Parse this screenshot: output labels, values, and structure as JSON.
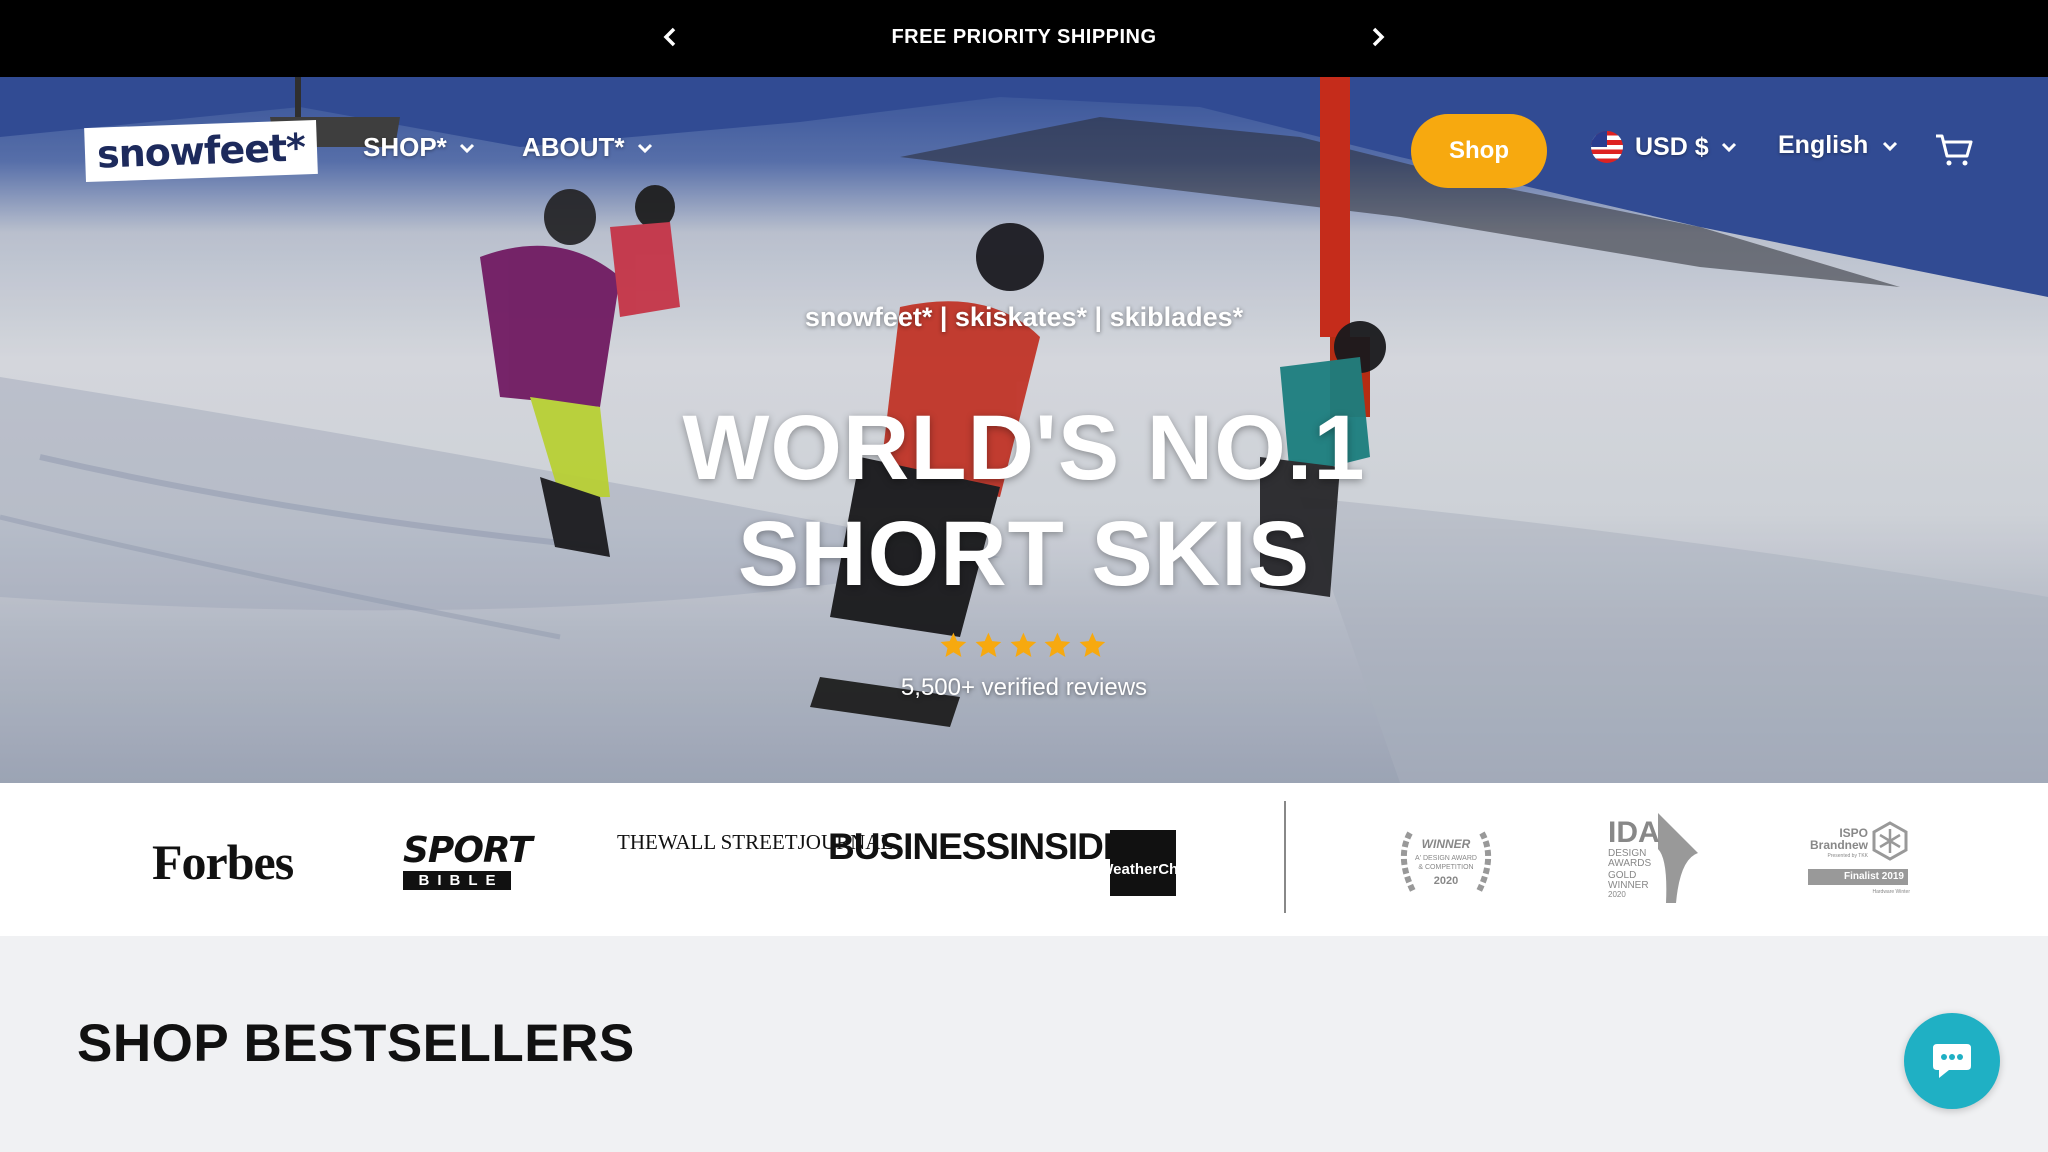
{
  "announcement": {
    "message": "FREE PRIORITY SHIPPING",
    "prev_icon": "chevron-left-icon",
    "next_icon": "chevron-right-icon"
  },
  "header": {
    "logo_text": "snowfeet*",
    "nav": [
      {
        "label": "SHOP*",
        "icon": "chevron-down-icon"
      },
      {
        "label": "ABOUT*",
        "icon": "chevron-down-icon"
      }
    ],
    "shop_button": "Shop",
    "currency": {
      "label": "USD $",
      "flag": "us-flag-icon"
    },
    "language": "English",
    "cart_icon": "cart-icon"
  },
  "hero": {
    "tagline": "snowfeet* | skiskates* | skiblades*",
    "headline_line1": "WORLD'S NO.1",
    "headline_line2": "SHORT SKIS",
    "rating": 5,
    "reviews": "5,500+ verified reviews"
  },
  "press": {
    "logos": [
      {
        "name": "Forbes",
        "text": "Forbes"
      },
      {
        "name": "Sport Bible",
        "text_top": "SPORT",
        "text_bottom": "BIBLE"
      },
      {
        "name": "The Wall Street Journal",
        "lines": [
          "THE",
          "WALL STREET",
          "JOURNAL."
        ]
      },
      {
        "name": "Business Insider",
        "lines": [
          "BUSINESS",
          "INSIDER"
        ]
      },
      {
        "name": "The Weather Channel",
        "lines": [
          "The",
          "Weather",
          "Channel"
        ]
      }
    ],
    "awards": [
      {
        "name": "A' Design Award",
        "lines": [
          "WINNER",
          "A' DESIGN AWARD",
          "& COMPETITION",
          "2020"
        ]
      },
      {
        "name": "IDA Design Awards",
        "lines": [
          "IDA",
          "DESIGN",
          "AWARDS",
          "GOLD",
          "WINNER",
          "2020"
        ]
      },
      {
        "name": "ISPO Brandnew",
        "lines": [
          "ISPO",
          "Brandnew",
          "Presented by TKK",
          "Finalist 2019",
          "Hardware Winter"
        ]
      }
    ]
  },
  "section": {
    "title": "SHOP BESTSELLERS"
  },
  "chat_icon": "chat-bubble-icon",
  "colors": {
    "accent": "#f7a90f",
    "chat": "#1fb0c4",
    "star": "#f7a90f"
  }
}
